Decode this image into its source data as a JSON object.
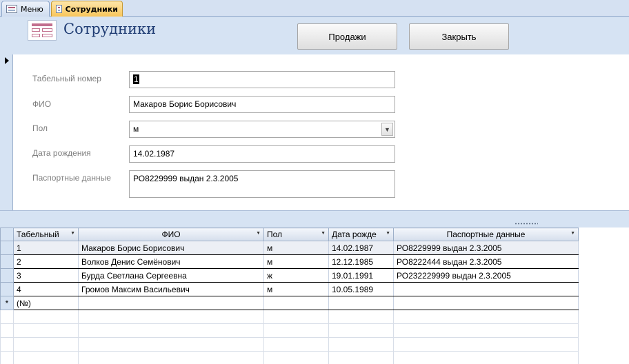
{
  "tabs": [
    {
      "label": "Меню",
      "active": false
    },
    {
      "label": "Сотрудники",
      "active": true
    }
  ],
  "header": {
    "title": "Сотрудники",
    "buttons": {
      "sales": "Продажи",
      "close": "Закрыть"
    }
  },
  "form": {
    "fields": {
      "tab_number": {
        "label": "Табельный номер",
        "value": "1"
      },
      "fio": {
        "label": "ФИО",
        "value": "Макаров Борис Борисович"
      },
      "gender": {
        "label": "Пол",
        "value": "м"
      },
      "birth_date": {
        "label": "Дата рождения",
        "value": "14.02.1987"
      },
      "passport": {
        "label": "Паспортные данные",
        "value": "РО8229999 выдан 2.3.2005"
      }
    }
  },
  "datasheet": {
    "columns": [
      "Табельный",
      "ФИО",
      "Пол",
      "Дата рожде",
      "Паспортные данные"
    ],
    "rows": [
      [
        "1",
        "Макаров Борис Борисович",
        "м",
        "14.02.1987",
        "РО8229999 выдан 2.3.2005"
      ],
      [
        "2",
        "Волков Денис Семёнович",
        "м",
        "12.12.1985",
        "РО8222444 выдан 2.3.2005"
      ],
      [
        "3",
        "Бурда Светлана Сергеевна",
        "ж",
        "19.01.1991",
        "РО232229999 выдан 2.3.2005"
      ],
      [
        "4",
        "Громов Максим Васильевич",
        "м",
        "10.05.1989",
        ""
      ]
    ],
    "new_row_marker": "*",
    "new_row_placeholder": "(№)"
  },
  "colors": {
    "accent_tab": "#f8c55a",
    "header_bg": "#d6e3f3",
    "title": "#1f3c73"
  }
}
